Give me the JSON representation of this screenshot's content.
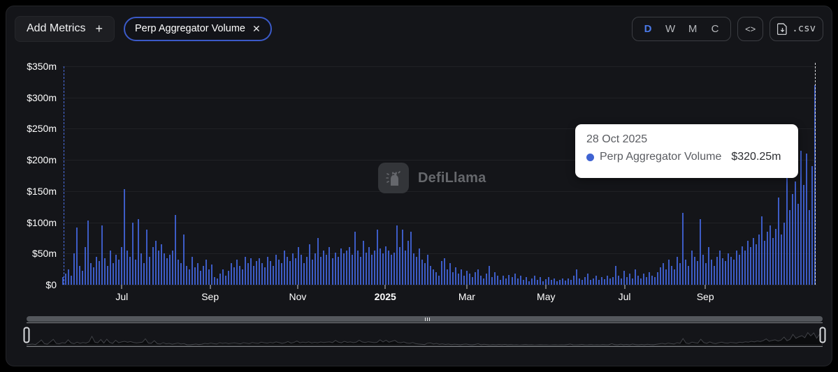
{
  "header": {
    "add_metrics_label": "Add Metrics",
    "add_metrics_plus": "+",
    "metric_pill": {
      "label": "Perp Aggregator Volume",
      "close_glyph": "✕"
    },
    "intervals": [
      {
        "label": "D",
        "active": true
      },
      {
        "label": "W",
        "active": false
      },
      {
        "label": "M",
        "active": false
      },
      {
        "label": "C",
        "active": false
      }
    ],
    "embed_label": "<>",
    "csv_label": ".csv"
  },
  "watermark": {
    "text": "DefiLlama"
  },
  "tooltip": {
    "date": "28 Oct 2025",
    "series_name": "Perp Aggregator Volume",
    "value": "$320.25m",
    "dot_color": "#3f63d2"
  },
  "colors": {
    "bar": "#3d5cc6",
    "pill_border": "#3b5ac8",
    "interval_active": "#4b79e8",
    "panel_bg": "#141519",
    "tooltip_bg": "#ffffff"
  },
  "chart_data": {
    "type": "bar",
    "title": "Perp Aggregator Volume",
    "unit": "USD millions",
    "interval": "daily",
    "ylim": [
      0,
      350
    ],
    "grid": true,
    "y_ticks": [
      "$350m",
      "$300m",
      "$250m",
      "$200m",
      "$150m",
      "$100m",
      "$50m",
      "$0"
    ],
    "x_ticks": [
      {
        "label": "Jul",
        "pos_pct": 7.9,
        "bold": false
      },
      {
        "label": "Sep",
        "pos_pct": 19.6,
        "bold": false
      },
      {
        "label": "Nov",
        "pos_pct": 31.2,
        "bold": false
      },
      {
        "label": "2025",
        "pos_pct": 42.8,
        "bold": true
      },
      {
        "label": "Mar",
        "pos_pct": 53.6,
        "bold": false
      },
      {
        "label": "May",
        "pos_pct": 64.1,
        "bold": false
      },
      {
        "label": "Jul",
        "pos_pct": 74.5,
        "bold": false
      },
      {
        "label": "Sep",
        "pos_pct": 85.2,
        "bold": false
      }
    ],
    "x_range": [
      "May 2024",
      "28 Oct 2025"
    ],
    "hover_point": {
      "date": "28 Oct 2025",
      "value_m": 320.25
    },
    "series": [
      {
        "name": "Perp Aggregator Volume",
        "color": "#3d5cc6",
        "values": [
          12,
          18,
          25,
          15,
          50,
          92,
          30,
          22,
          60,
          103,
          35,
          28,
          45,
          38,
          95,
          42,
          30,
          55,
          35,
          48,
          40,
          60,
          153,
          55,
          45,
          100,
          40,
          105,
          50,
          35,
          88,
          45,
          60,
          70,
          55,
          65,
          50,
          42,
          48,
          55,
          112,
          40,
          35,
          80,
          30,
          25,
          45,
          28,
          35,
          22,
          30,
          40,
          25,
          32,
          12,
          10,
          18,
          25,
          15,
          22,
          35,
          28,
          40,
          30,
          25,
          45,
          35,
          42,
          30,
          38,
          42,
          35,
          28,
          45,
          38,
          30,
          48,
          40,
          35,
          55,
          45,
          38,
          50,
          42,
          60,
          48,
          35,
          45,
          65,
          40,
          50,
          75,
          45,
          55,
          48,
          60,
          42,
          52,
          45,
          58,
          50,
          55,
          60,
          48,
          85,
          55,
          45,
          70,
          52,
          60,
          48,
          55,
          88,
          58,
          50,
          62,
          55,
          48,
          52,
          95,
          60,
          88,
          55,
          70,
          85,
          50,
          45,
          58,
          40,
          35,
          48,
          30,
          25,
          20,
          15,
          38,
          42,
          25,
          35,
          20,
          28,
          18,
          25,
          15,
          22,
          18,
          12,
          20,
          25,
          15,
          10,
          18,
          30,
          12,
          20,
          15,
          8,
          14,
          10,
          16,
          12,
          18,
          10,
          14,
          8,
          12,
          6,
          10,
          14,
          8,
          12,
          6,
          9,
          12,
          8,
          10,
          6,
          8,
          10,
          7,
          10,
          8,
          14,
          25,
          10,
          8,
          12,
          18,
          8,
          10,
          15,
          8,
          12,
          9,
          14,
          10,
          12,
          30,
          15,
          10,
          22,
          12,
          18,
          10,
          25,
          14,
          10,
          18,
          12,
          20,
          15,
          12,
          20,
          28,
          35,
          25,
          40,
          30,
          25,
          45,
          35,
          115,
          40,
          30,
          55,
          45,
          38,
          105,
          48,
          35,
          60,
          40,
          30,
          45,
          55,
          42,
          38,
          50,
          45,
          40,
          55,
          48,
          62,
          55,
          70,
          60,
          75,
          65,
          80,
          110,
          70,
          85,
          95,
          75,
          90,
          140,
          80,
          100,
          185,
          120,
          145,
          165,
          130,
          215,
          160,
          210,
          120,
          190,
          320
        ]
      }
    ]
  }
}
